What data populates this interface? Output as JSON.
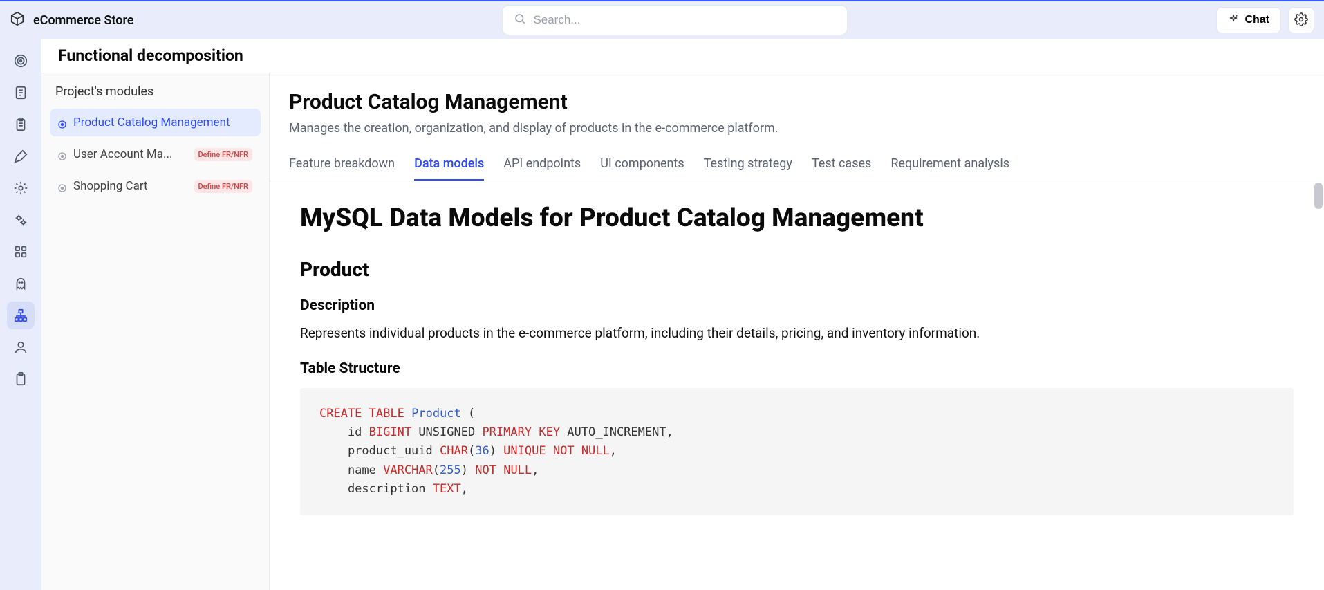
{
  "topbar": {
    "app_title": "eCommerce Store",
    "search_placeholder": "Search...",
    "chat_label": "Chat"
  },
  "page": {
    "title": "Functional decomposition"
  },
  "sidebar": {
    "heading": "Project's modules",
    "modules": [
      {
        "label": "Product Catalog Management",
        "active": true,
        "badge": ""
      },
      {
        "label": "User Account Ma...",
        "active": false,
        "badge": "Define FR/NFR"
      },
      {
        "label": "Shopping Cart",
        "active": false,
        "badge": "Define FR/NFR"
      }
    ]
  },
  "detail": {
    "title": "Product Catalog Management",
    "description": "Manages the creation, organization, and display of products in the e-commerce platform."
  },
  "tabs": [
    {
      "label": "Feature breakdown",
      "active": false
    },
    {
      "label": "Data models",
      "active": true
    },
    {
      "label": "API endpoints",
      "active": false
    },
    {
      "label": "UI components",
      "active": false
    },
    {
      "label": "Testing strategy",
      "active": false
    },
    {
      "label": "Test cases",
      "active": false
    },
    {
      "label": "Requirement analysis",
      "active": false
    }
  ],
  "doc": {
    "h1": "MySQL Data Models for Product Catalog Management",
    "h2": "Product",
    "desc_heading": "Description",
    "desc_text": "Represents individual products in the e-commerce platform, including their details, pricing, and inventory information.",
    "table_heading": "Table Structure",
    "sql": {
      "l1_a": "CREATE",
      "l1_b": "TABLE",
      "l1_c": "Product",
      "l1_d": " (",
      "l2_a": "    id ",
      "l2_b": "BIGINT",
      "l2_c": " UNSIGNED ",
      "l2_d": "PRIMARY",
      "l2_e": " ",
      "l2_f": "KEY",
      "l2_g": " AUTO_INCREMENT,",
      "l3_a": "    product_uuid ",
      "l3_b": "CHAR",
      "l3_c": "(",
      "l3_d": "36",
      "l3_e": ") ",
      "l3_f": "UNIQUE",
      "l3_g": " ",
      "l3_h": "NOT",
      "l3_i": " ",
      "l3_j": "NULL",
      "l3_k": ",",
      "l4_a": "    name ",
      "l4_b": "VARCHAR",
      "l4_c": "(",
      "l4_d": "255",
      "l4_e": ") ",
      "l4_f": "NOT",
      "l4_g": " ",
      "l4_h": "NULL",
      "l4_i": ",",
      "l5_a": "    description ",
      "l5_b": "TEXT",
      "l5_c": ","
    }
  }
}
